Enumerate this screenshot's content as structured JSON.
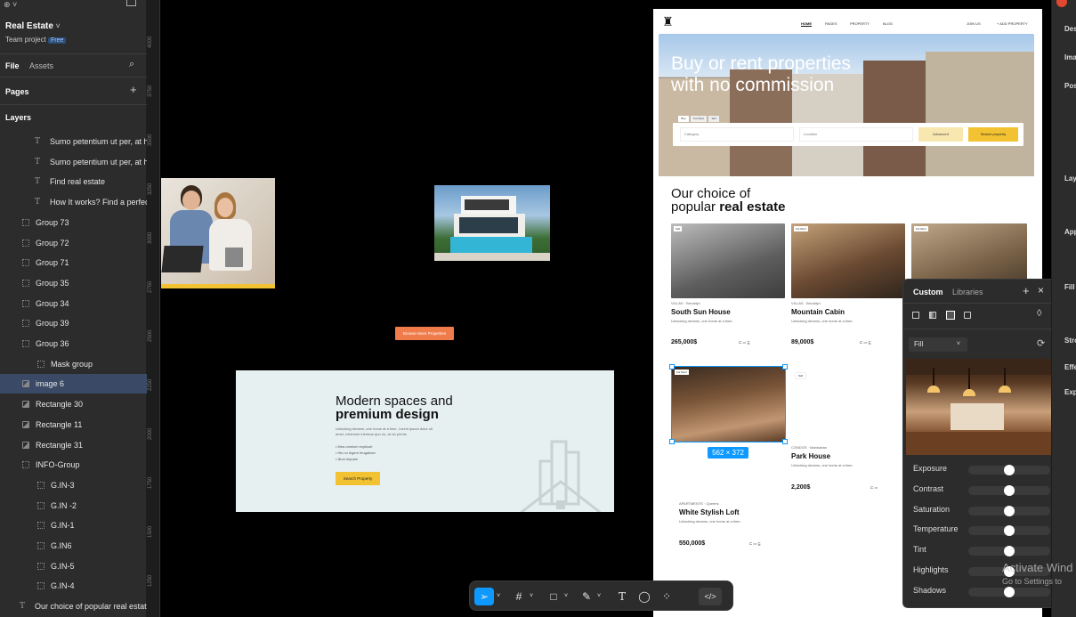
{
  "sidebar": {
    "file_name": "Real Estate",
    "team": "Team project",
    "plan_badge": "Free",
    "tab_file": "File",
    "tab_assets": "Assets",
    "pages_label": "Pages",
    "layers_label": "Layers",
    "layers": [
      {
        "label": "Sumo petentium ut per, at his",
        "kind": "text",
        "indent": 2
      },
      {
        "label": "Sumo petentium ut per, at his",
        "kind": "text",
        "indent": 2
      },
      {
        "label": "Find real estate",
        "kind": "text",
        "indent": 2
      },
      {
        "label": "How It works? Find a perfect",
        "kind": "text",
        "indent": 2
      },
      {
        "label": "Group 73",
        "kind": "group",
        "indent": 1
      },
      {
        "label": "Group 72",
        "kind": "group",
        "indent": 1
      },
      {
        "label": "Group 71",
        "kind": "group",
        "indent": 1
      },
      {
        "label": "Group 35",
        "kind": "group",
        "indent": 1
      },
      {
        "label": "Group 34",
        "kind": "group",
        "indent": 1
      },
      {
        "label": "Group 39",
        "kind": "group",
        "indent": 1
      },
      {
        "label": "Group 36",
        "kind": "group",
        "indent": 1
      },
      {
        "label": "Mask group",
        "kind": "group",
        "indent": 2
      },
      {
        "label": "image 6",
        "kind": "image",
        "indent": 1,
        "selected": true
      },
      {
        "label": "Rectangle 30",
        "kind": "image",
        "indent": 1
      },
      {
        "label": "Rectangle 11",
        "kind": "image",
        "indent": 1
      },
      {
        "label": "Rectangle 31",
        "kind": "image",
        "indent": 1
      },
      {
        "label": "INFO-Group",
        "kind": "group",
        "indent": 1
      },
      {
        "label": "G.IN-3",
        "kind": "group",
        "indent": 2
      },
      {
        "label": "G.IN -2",
        "kind": "group",
        "indent": 2
      },
      {
        "label": "G.IN-1",
        "kind": "group",
        "indent": 2
      },
      {
        "label": "G.IN6",
        "kind": "group",
        "indent": 2
      },
      {
        "label": "G.IN-5",
        "kind": "group",
        "indent": 2
      },
      {
        "label": "G.IN-4",
        "kind": "group",
        "indent": 2
      },
      {
        "label": "Our choice of popular real estate",
        "kind": "text",
        "indent": 1
      }
    ]
  },
  "ruler": [
    "4000",
    "3750",
    "3500",
    "3250",
    "3000",
    "2750",
    "2500",
    "2250",
    "2000",
    "1750",
    "1500",
    "1250"
  ],
  "canvas": {
    "browse_button": "Browse More Properties",
    "promo_title_1": "Modern spaces and",
    "promo_title_2": "premium design",
    "promo_text_1": "Unlocking dreams, one home at a time. Lorem ipsum dolor sit",
    "promo_text_2": "amet, minimum inimicus quo no, at vix primis.",
    "promo_bullet_1": "• Mea omnium explicari",
    "promo_bullet_2": "• His no legere feugaitoer",
    "promo_bullet_3": "• Illum iriquam",
    "promo_button": "Search Property"
  },
  "site": {
    "nav": [
      "HOME",
      "PAGES",
      "PROPERTY",
      "BLOG"
    ],
    "nav_right_1": "JOIN US",
    "nav_right_2": "+ ADD PROPERTY",
    "hero_line_1": "Buy or rent properties",
    "hero_line_2": "with no commission",
    "search_tabs": [
      "Buy",
      "For Rent",
      "Sell"
    ],
    "category_ph": "Category",
    "location_ph": "Location",
    "advanced_btn": "Advanced",
    "search_btn": "Search property",
    "section_title_1": "Our choice of",
    "section_title_2_a": "popular ",
    "section_title_2_b": "real estate",
    "cards": [
      {
        "tag": "Sell",
        "loc": "VILLAS · Brooklyn",
        "name": "South Sun House",
        "desc": "Unlocking dreams, one home at a time.",
        "price": "265,000$"
      },
      {
        "tag": "For Rent",
        "loc": "VILLAS · Brooklyn",
        "name": "Mountain Cabin",
        "desc": "Unlocking dreams, one home at a time.",
        "price": "89,000$"
      },
      {
        "tag": "For Rent",
        "loc": "",
        "name": "",
        "desc": "",
        "price": ""
      },
      {
        "tag": "For Rent",
        "loc": "APARTMENTS · Queens",
        "name": "White Stylish Loft",
        "desc": "Unlocking dreams, one home at a time.",
        "price": "550,000$"
      },
      {
        "tag": "Sell",
        "loc": "CONDOS · Manhattan",
        "name": "Park House",
        "desc": "Unlocking dreams, one home at a time.",
        "price": "2,200$"
      }
    ],
    "dimension_badge": "562 × 372"
  },
  "image_panel": {
    "tab_custom": "Custom",
    "tab_libraries": "Libraries",
    "fill_label": "Fill",
    "sliders": [
      {
        "label": "Exposure",
        "value": 0.5
      },
      {
        "label": "Contrast",
        "value": 0.5
      },
      {
        "label": "Saturation",
        "value": 0.5
      },
      {
        "label": "Temperature",
        "value": 0.5
      },
      {
        "label": "Tint",
        "value": 0.5
      },
      {
        "label": "Highlights",
        "value": 0.5
      },
      {
        "label": "Shadows",
        "value": 0.5
      }
    ]
  },
  "right_panel": [
    "Des",
    "Ima",
    "Pos",
    "Lay",
    "App",
    "Fill",
    "Stro",
    "Effe",
    "Exp"
  ],
  "watermark_1": "Activate Wind",
  "watermark_2": "Go to Settings to",
  "colors": {
    "accent": "#0d99ff",
    "select_bg": "#3a4a66",
    "orange": "#f07c4c",
    "yellow": "#f2c232"
  }
}
